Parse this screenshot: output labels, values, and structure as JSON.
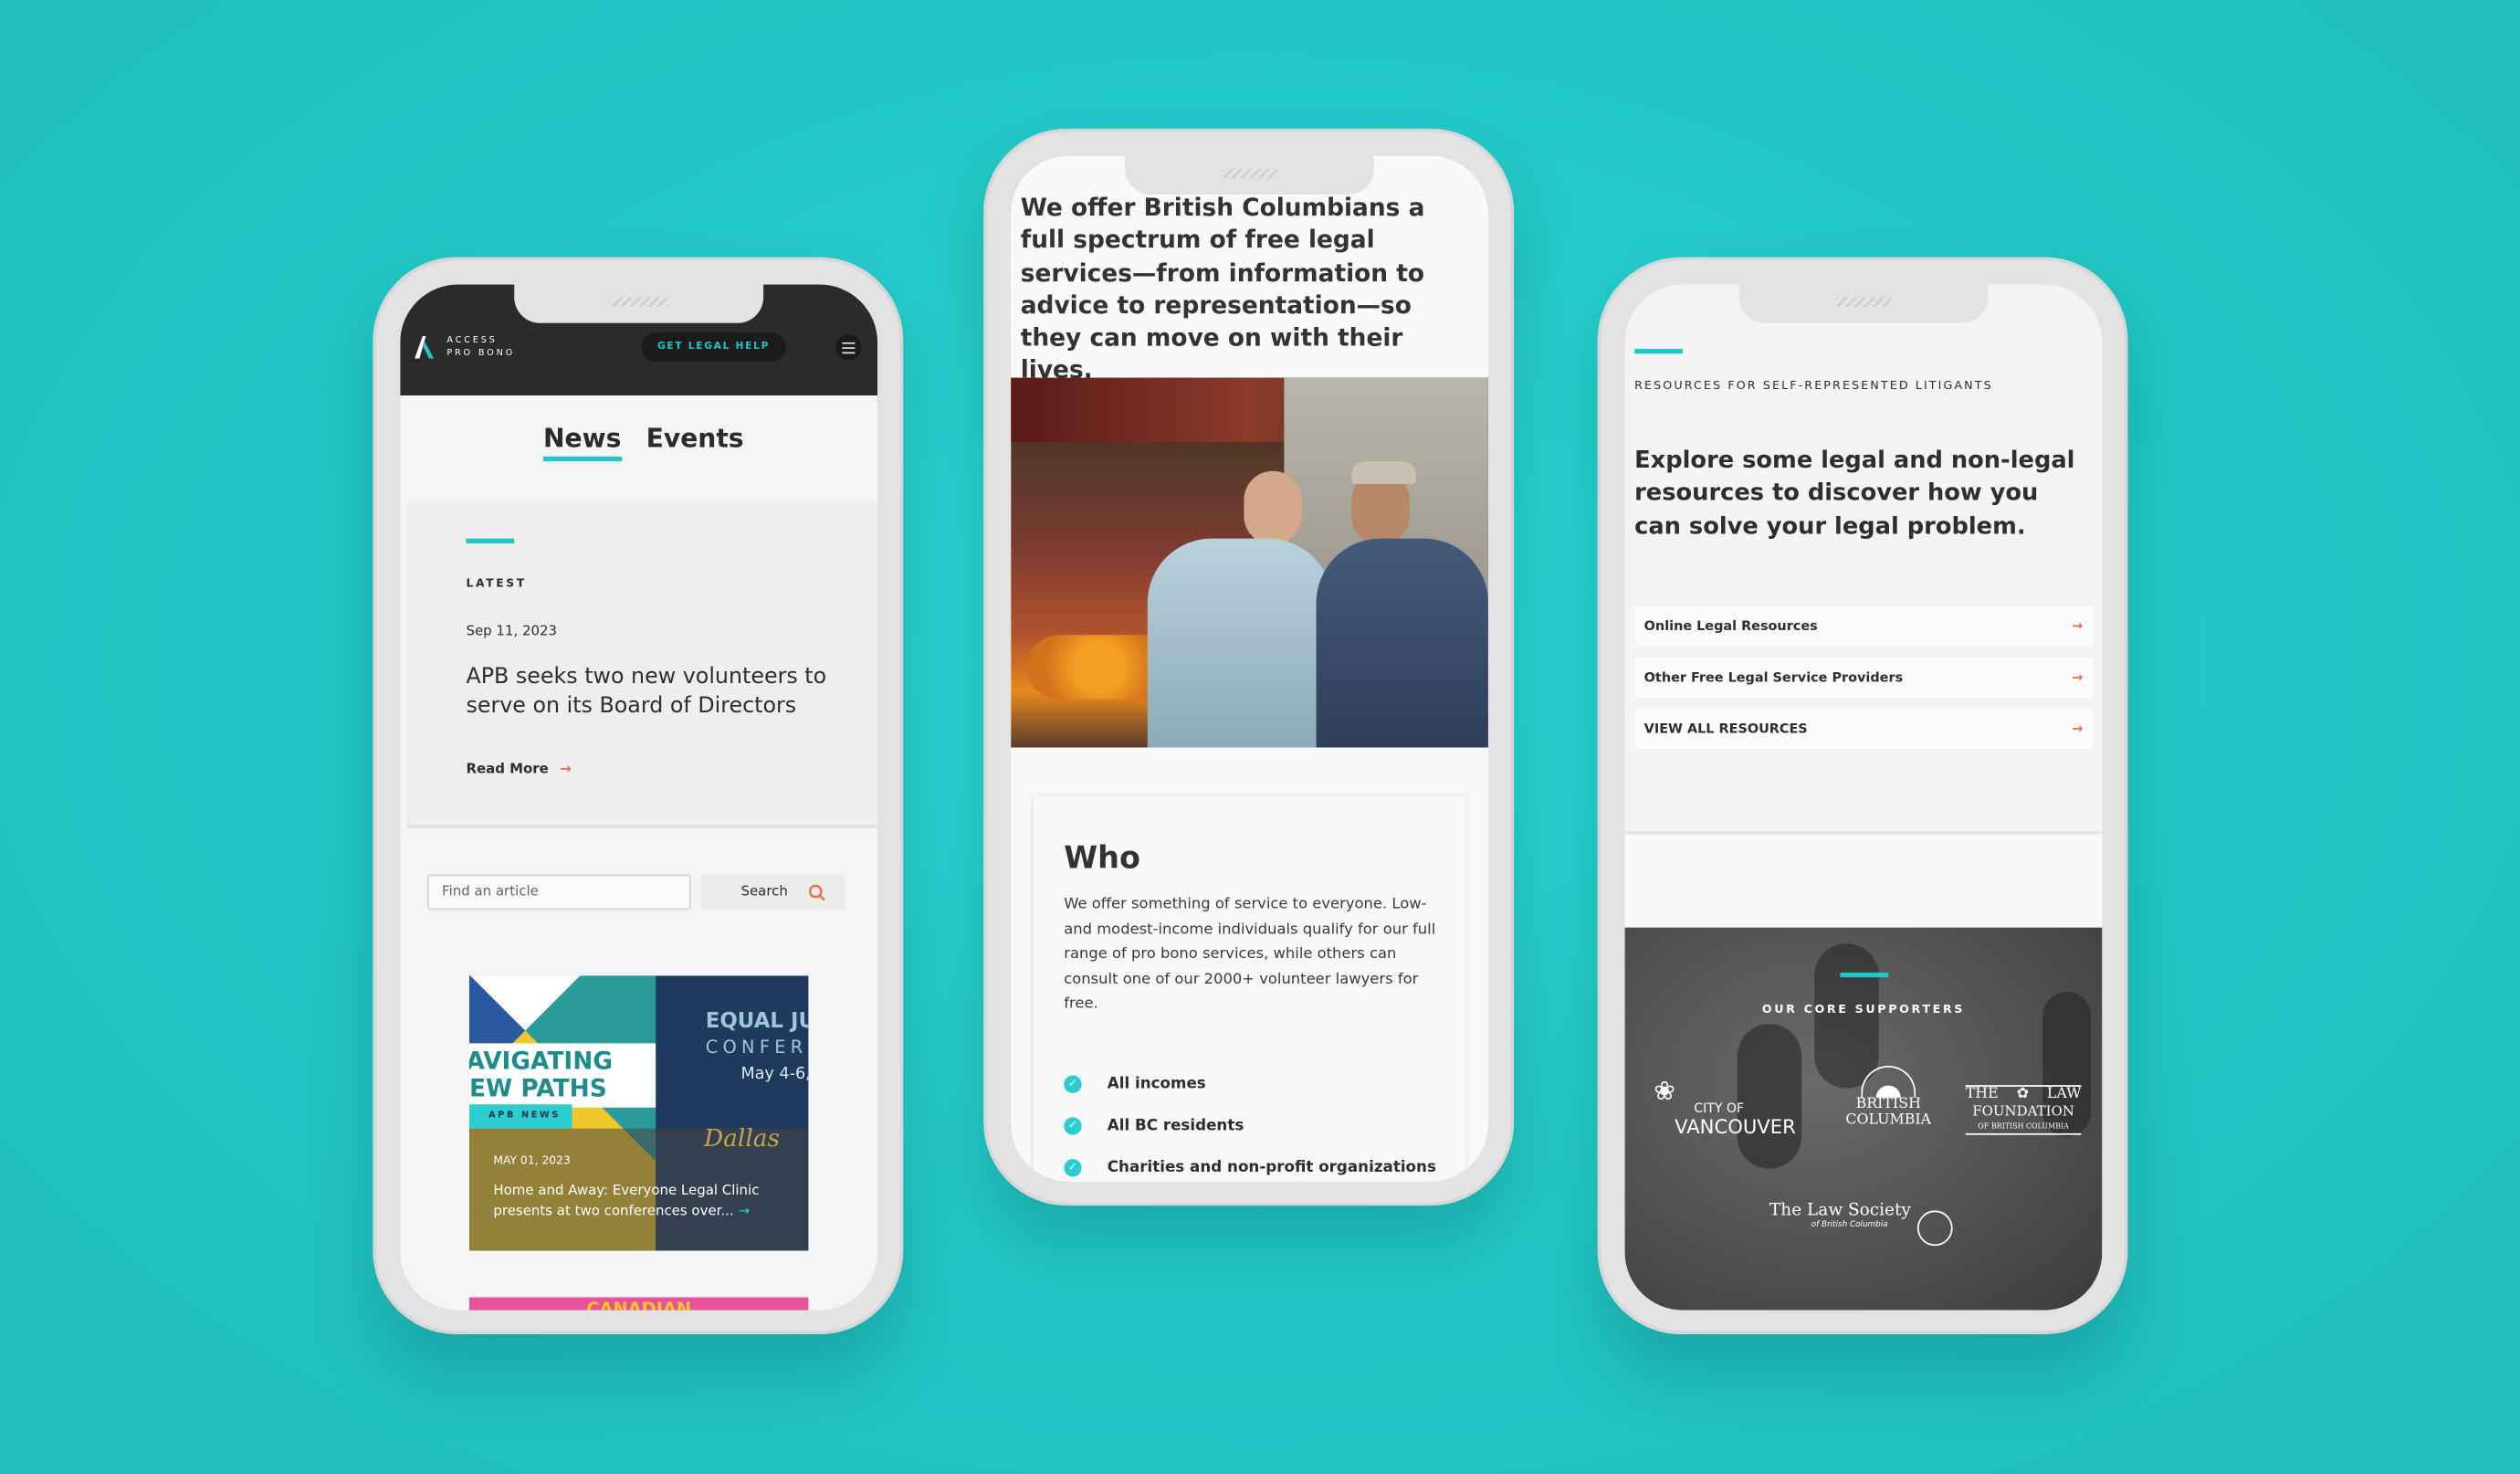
{
  "colors": {
    "background": "#22c6c6",
    "accent": "#22c7c9",
    "arrow": "#ef6b45",
    "header": "#2b2b2b"
  },
  "left_phone": {
    "logo": {
      "line1": "ACCESS",
      "line2": "PRO BONO"
    },
    "cta_label": "GET LEGAL HELP",
    "menu_icon": "hamburger-icon",
    "tabs": [
      {
        "label": "News",
        "active": true
      },
      {
        "label": "Events",
        "active": false
      }
    ],
    "latest": {
      "kicker": "LATEST",
      "date": "Sep 11, 2023",
      "title": "APB seeks two new volunteers to serve on its Board of Directors",
      "read_more": "Read More"
    },
    "search": {
      "placeholder": "Find an article",
      "button": "Search"
    },
    "article": {
      "image_text_1": "AVIGATING",
      "image_text_2": "EW PATHS",
      "image_text_3": "EQUAL JU",
      "image_text_4": "CONFER",
      "image_text_5": "May 4-6,",
      "image_text_6": "Dallas",
      "tag": "APB NEWS",
      "date": "MAY 01, 2023",
      "title": "Home and Away: Everyone Legal Clinic presents at two conferences over..."
    },
    "next_card_text": "CANADIAN"
  },
  "middle_phone": {
    "intro": "We offer British Columbians a full spectrum of free legal services—from information to advice to representation—so they can move on with their lives.",
    "who": {
      "heading": "Who",
      "body": "We offer something of service to everyone. Low- and modest-income individuals qualify for our full range of pro bono services, while others can consult one of our 2000+ volunteer lawyers for free.",
      "items": [
        "All incomes",
        "All BC residents",
        "Charities and non-profit organizations"
      ]
    }
  },
  "right_phone": {
    "kicker": "RESOURCES FOR SELF-REPRESENTED LITIGANTS",
    "heading": "Explore some legal and non-legal resources to discover how you can solve your legal problem.",
    "links": [
      "Online Legal Resources",
      "Other Free Legal Service Providers",
      "VIEW ALL RESOURCES"
    ],
    "supporters": {
      "heading": "OUR CORE SUPPORTERS",
      "logos": {
        "vancouver": [
          "CITY OF",
          "VANCOUVER"
        ],
        "bc": [
          "BRITISH",
          "COLUMBIA"
        ],
        "law_foundation": [
          "THE",
          "LAW",
          "FOUNDATION",
          "OF BRITISH COLUMBIA"
        ],
        "law_society": [
          "The Law Society",
          "of British Columbia"
        ]
      }
    }
  }
}
